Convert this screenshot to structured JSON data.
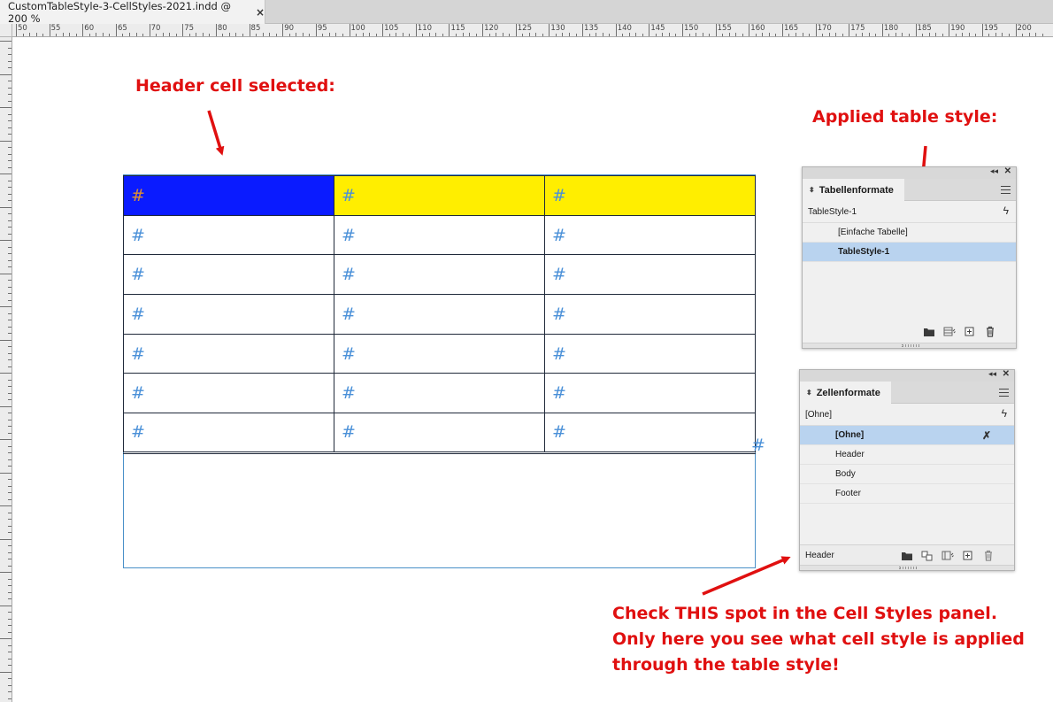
{
  "document_tab": {
    "title": "CustomTableStyle-3-CellStyles-2021.indd @ 200 %",
    "close_symbol": "×"
  },
  "ruler": {
    "labels": [
      "50",
      "55",
      "60",
      "65",
      "70",
      "75",
      "80",
      "85",
      "90",
      "95",
      "100",
      "105",
      "110",
      "115",
      "120",
      "125",
      "130",
      "135",
      "140",
      "145",
      "150",
      "155",
      "160",
      "165",
      "170",
      "175",
      "180",
      "185",
      "190",
      "195",
      "200"
    ]
  },
  "annotations": {
    "header_cell": "Header cell selected:",
    "table_style": "Applied table style:",
    "check_line1": "Check THIS spot in the Cell Styles panel.",
    "check_line2": "Only here you see what cell style is applied",
    "check_line3": "through the table style!",
    "color": "#e01010"
  },
  "table": {
    "cell_glyph": "#",
    "overset_glyph": "#",
    "rows": 7,
    "columns": 3,
    "header_color": "#ffee00",
    "selected_cell_color": "#0a1bff"
  },
  "table_styles_panel": {
    "tab_label": "Tabellenformate",
    "current_style": "TableStyle-1",
    "items": [
      {
        "label": "[Einfache Tabelle]",
        "selected": false
      },
      {
        "label": "TableStyle-1",
        "selected": true
      }
    ],
    "footer_icons": [
      "folder-icon",
      "table-style-options-icon",
      "new-style-icon",
      "trash-icon"
    ],
    "selection_color": "#b9d3ef"
  },
  "cell_styles_panel": {
    "tab_label": "Zellenformate",
    "current_style": "[Ohne]",
    "items": [
      {
        "label": "[Ohne]",
        "selected": true
      },
      {
        "label": "Header",
        "selected": false
      },
      {
        "label": "Body",
        "selected": false
      },
      {
        "label": "Footer",
        "selected": false
      }
    ],
    "footer_label": "Header",
    "footer_icons": [
      "folder-icon",
      "map-styles-icon",
      "cell-style-options-icon",
      "new-style-icon",
      "trash-icon"
    ]
  }
}
